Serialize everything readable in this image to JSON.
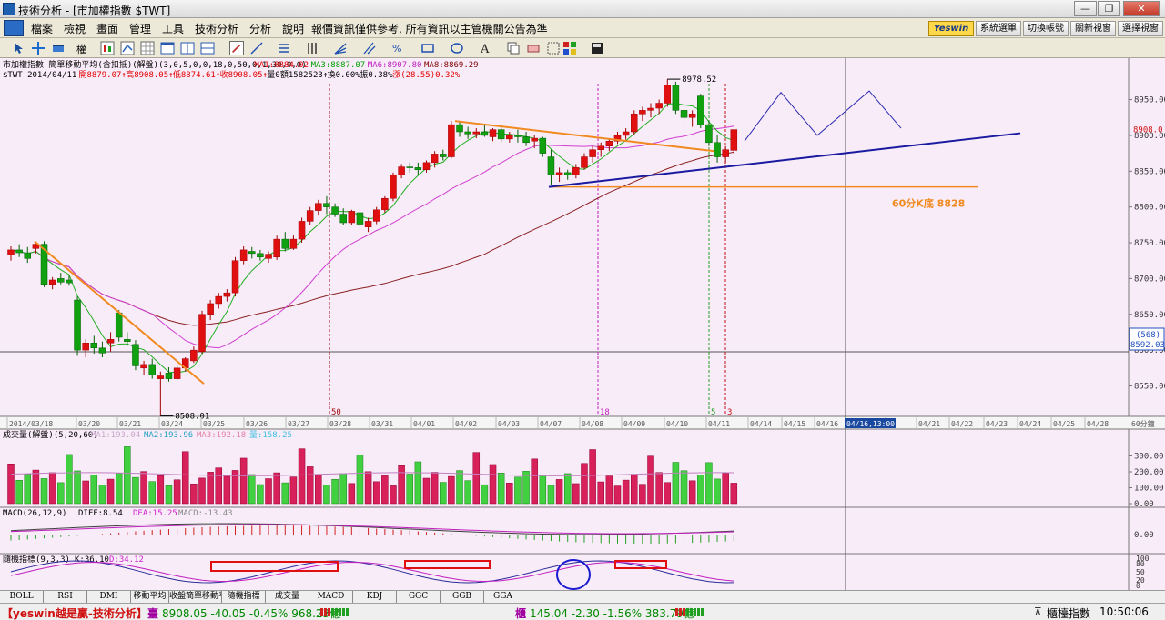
{
  "window": {
    "title": "技術分析 - [市加權指數 $TWT]",
    "minimize": "—",
    "restore": "❐",
    "close": "✕"
  },
  "menu": {
    "items": [
      "檔案",
      "檢視",
      "畫面",
      "管理",
      "工具",
      "技術分析",
      "分析",
      "說明"
    ],
    "notice": "報價資訊僅供參考, 所有資訊以主管機關公告為準",
    "brand": "Yeswin",
    "buttons": [
      "系統選單",
      "切換帳號",
      "關新視窗",
      "選擇視窗"
    ]
  },
  "toolbar": {
    "kline_label": "權",
    "icons": [
      "cursor-icon",
      "crosshair-icon",
      "bar-icon",
      "kline-icon",
      "zoom-icon",
      "grid-icon",
      "window-icon",
      "compare-icon",
      "draw-pen-icon",
      "line-tool-icon",
      "text-tool-icon",
      "bars-tool-icon",
      "fan-tool-icon",
      "gann-tool-icon",
      "percent-tool-icon",
      "rect-tool-icon",
      "ellipse-tool-icon",
      "font-tool-icon",
      "copy-icon",
      "erase-icon",
      "color-icon",
      "save-icon"
    ]
  },
  "chart": {
    "header_line1_prefix": "市加權指數  簡單移動平均(含扣抵)(解盤)(3,0,5,0,0,18,0,50,0,1,30,0,0)",
    "ma_labels": [
      {
        "text": "MA1:8884.02",
        "color": "#e00000"
      },
      {
        "text": "MA3:8887.07",
        "color": "#00a000"
      },
      {
        "text": "MA6:8907.80",
        "color": "#c020c0"
      },
      {
        "text": "MA8:8869.29",
        "color": "#800000"
      }
    ],
    "header_line2": [
      {
        "text": "$TWT 2014/04/11",
        "color": "#000"
      },
      {
        "text": "開8879.07↑",
        "color": "#e00000"
      },
      {
        "text": "高8908.05↑",
        "color": "#e00000"
      },
      {
        "text": "低8874.61↑",
        "color": "#e00000"
      },
      {
        "text": "收8908.05↑",
        "color": "#e00000"
      },
      {
        "text": "量0",
        "color": "#000"
      },
      {
        "text": "額1582523↑",
        "color": "#000"
      },
      {
        "text": "換0.00%",
        "color": "#000"
      },
      {
        "text": "振0.38%",
        "color": "#000"
      },
      {
        "text": "漲(28.55)0.32%",
        "color": "#e00000"
      }
    ],
    "price_axis": [
      "8950.00",
      "8900.00",
      "8850.00",
      "8800.00",
      "8750.00",
      "8700.00",
      "8650.00",
      "8600.00",
      "8550.00"
    ],
    "price_axis_values": [
      8950,
      8900,
      8850,
      8800,
      8750,
      8700,
      8650,
      8600,
      8550
    ],
    "current_price_tag": "8908.0",
    "cursor_tag_top": "(568)",
    "cursor_tag_bottom": "8592.03",
    "high_label": "8978.52",
    "low_label": "8508.01",
    "support_label": "60分K底 8828",
    "marker_labels": [
      {
        "text": "50",
        "color": "#a01010"
      },
      {
        "text": "18",
        "color": "#c020c0"
      },
      {
        "text": "5",
        "color": "#20a020"
      },
      {
        "text": "3",
        "color": "#c01010"
      }
    ],
    "date_axis": [
      "2014/03/18",
      "03/20",
      "03/21",
      "03/24",
      "03/25",
      "03/26",
      "03/27",
      "03/28",
      "03/31",
      "04/01",
      "04/02",
      "04/03",
      "04/07",
      "04/08",
      "04/09",
      "04/10",
      "04/11",
      "04/14",
      "04/15",
      "04/16",
      "18",
      "04/21",
      "04/22",
      "04/23",
      "04/24",
      "04/25",
      "04/28"
    ],
    "cursor_date": "04/16,13:00",
    "period_label": "60分鐘"
  },
  "volume": {
    "header": "成交量(解盤)(5,20,60)",
    "ma_labels": [
      {
        "text": "MA1:193.04",
        "color": "#c8a8c8"
      },
      {
        "text": "MA2:193.96",
        "color": "#20a0c0"
      },
      {
        "text": "MA3:192.18",
        "color": "#e080a0"
      },
      {
        "text": "量:158.25",
        "color": "#40c0e0"
      }
    ],
    "axis": [
      "300.00",
      "200.00",
      "100.00",
      "0.00"
    ]
  },
  "macd": {
    "header": "MACD(26,12,9)",
    "diff": "DIFF:8.54",
    "dea": "DEA:15.25",
    "macd": "MACD:-13.43",
    "axis": [
      "0.00"
    ]
  },
  "kd": {
    "header": "隨機指標(9,3,3)",
    "k": "K:36.10",
    "d": "D:34.12",
    "axis": [
      "100",
      "80",
      "50",
      "20",
      "0"
    ]
  },
  "indicator_tabs": [
    "BOLL",
    "RSI",
    "DMI",
    "移動平均",
    "收盤簡單移動平",
    "隨機指標",
    "成交量",
    "MACD",
    "KDJ",
    "GGC",
    "GGB",
    "GGA"
  ],
  "status": {
    "brand": "【yeswin越是贏-技術分析】",
    "twse_label": "臺",
    "twse_quote": "8908.05 -40.05 -0.45% 968.23億",
    "otc_label": "櫃",
    "otc_quote": "145.04 -2.30 -1.56% 383.79億",
    "index_name": "櫃檯指數",
    "time": "10:50:06"
  },
  "chart_data": {
    "type": "candlestick",
    "timeframe": "60分",
    "symbol": "$TWT",
    "ohlc": [
      [
        8733,
        8745,
        8725,
        8740
      ],
      [
        8740,
        8748,
        8730,
        8736
      ],
      [
        8736,
        8744,
        8722,
        8728
      ],
      [
        8742,
        8752,
        8735,
        8748
      ],
      [
        8748,
        8752,
        8688,
        8692
      ],
      [
        8692,
        8702,
        8685,
        8698
      ],
      [
        8700,
        8708,
        8692,
        8695
      ],
      [
        8698,
        8704,
        8690,
        8694
      ],
      [
        8670,
        8675,
        8592,
        8600
      ],
      [
        8600,
        8615,
        8590,
        8610
      ],
      [
        8610,
        8620,
        8595,
        8603
      ],
      [
        8603,
        8612,
        8590,
        8596
      ],
      [
        8610,
        8625,
        8598,
        8615
      ],
      [
        8652,
        8656,
        8612,
        8618
      ],
      [
        8615,
        8625,
        8606,
        8612
      ],
      [
        8608,
        8614,
        8572,
        8578
      ],
      [
        8575,
        8585,
        8565,
        8580
      ],
      [
        8580,
        8588,
        8560,
        8565
      ],
      [
        8560,
        8570,
        8508,
        8564
      ],
      [
        8568,
        8576,
        8556,
        8560
      ],
      [
        8560,
        8580,
        8558,
        8575
      ],
      [
        8575,
        8590,
        8570,
        8588
      ],
      [
        8585,
        8605,
        8582,
        8600
      ],
      [
        8598,
        8655,
        8595,
        8650
      ],
      [
        8650,
        8670,
        8642,
        8665
      ],
      [
        8665,
        8680,
        8658,
        8675
      ],
      [
        8675,
        8685,
        8668,
        8680
      ],
      [
        8680,
        8730,
        8675,
        8725
      ],
      [
        8725,
        8745,
        8720,
        8740
      ],
      [
        8738,
        8744,
        8728,
        8735
      ],
      [
        8735,
        8740,
        8725,
        8730
      ],
      [
        8728,
        8738,
        8722,
        8734
      ],
      [
        8730,
        8760,
        8726,
        8755
      ],
      [
        8755,
        8765,
        8738,
        8742
      ],
      [
        8742,
        8760,
        8740,
        8755
      ],
      [
        8755,
        8785,
        8750,
        8780
      ],
      [
        8780,
        8800,
        8775,
        8795
      ],
      [
        8795,
        8810,
        8788,
        8805
      ],
      [
        8805,
        8815,
        8790,
        8800
      ],
      [
        8800,
        8805,
        8786,
        8790
      ],
      [
        8790,
        8798,
        8775,
        8778
      ],
      [
        8778,
        8796,
        8775,
        8794
      ],
      [
        8792,
        8798,
        8770,
        8776
      ],
      [
        8772,
        8785,
        8765,
        8780
      ],
      [
        8780,
        8800,
        8776,
        8796
      ],
      [
        8796,
        8815,
        8792,
        8812
      ],
      [
        8812,
        8848,
        8808,
        8845
      ],
      [
        8845,
        8860,
        8840,
        8856
      ],
      [
        8856,
        8862,
        8848,
        8855
      ],
      [
        8855,
        8862,
        8845,
        8852
      ],
      [
        8852,
        8865,
        8848,
        8862
      ],
      [
        8862,
        8878,
        8855,
        8874
      ],
      [
        8874,
        8880,
        8865,
        8870
      ],
      [
        8870,
        8920,
        8868,
        8915
      ],
      [
        8915,
        8920,
        8898,
        8905
      ],
      [
        8905,
        8912,
        8895,
        8902
      ],
      [
        8902,
        8910,
        8896,
        8905
      ],
      [
        8905,
        8915,
        8898,
        8900
      ],
      [
        8898,
        8910,
        8892,
        8908
      ],
      [
        8908,
        8912,
        8890,
        8895
      ],
      [
        8895,
        8905,
        8890,
        8900
      ],
      [
        8900,
        8908,
        8890,
        8898
      ],
      [
        8898,
        8905,
        8885,
        8890
      ],
      [
        8892,
        8900,
        8882,
        8896
      ],
      [
        8896,
        8898,
        8870,
        8875
      ],
      [
        8870,
        8880,
        8830,
        8845
      ],
      [
        8845,
        8855,
        8835,
        8848
      ],
      [
        8848,
        8852,
        8838,
        8845
      ],
      [
        8845,
        8860,
        8840,
        8855
      ],
      [
        8855,
        8875,
        8852,
        8870
      ],
      [
        8870,
        8885,
        8862,
        8880
      ],
      [
        8880,
        8890,
        8870,
        8885
      ],
      [
        8885,
        8895,
        8878,
        8892
      ],
      [
        8892,
        8905,
        8888,
        8900
      ],
      [
        8900,
        8910,
        8894,
        8905
      ],
      [
        8905,
        8935,
        8900,
        8930
      ],
      [
        8930,
        8940,
        8920,
        8935
      ],
      [
        8935,
        8945,
        8925,
        8938
      ],
      [
        8938,
        8950,
        8930,
        8945
      ],
      [
        8945,
        8978.52,
        8940,
        8970
      ],
      [
        8970,
        8975,
        8930,
        8935
      ],
      [
        8935,
        8945,
        8915,
        8925
      ],
      [
        8925,
        8935,
        8912,
        8930
      ],
      [
        8955,
        8958,
        8910,
        8915
      ],
      [
        8915,
        8920,
        8885,
        8890
      ],
      [
        8890,
        8900,
        8862,
        8870
      ],
      [
        8870,
        8885,
        8862,
        8880
      ],
      [
        8879.07,
        8908.05,
        8874.61,
        8908.05
      ]
    ],
    "high": 8978.52,
    "low": 8508.01,
    "support": 8828,
    "ylim": [
      8510,
      8985
    ]
  }
}
